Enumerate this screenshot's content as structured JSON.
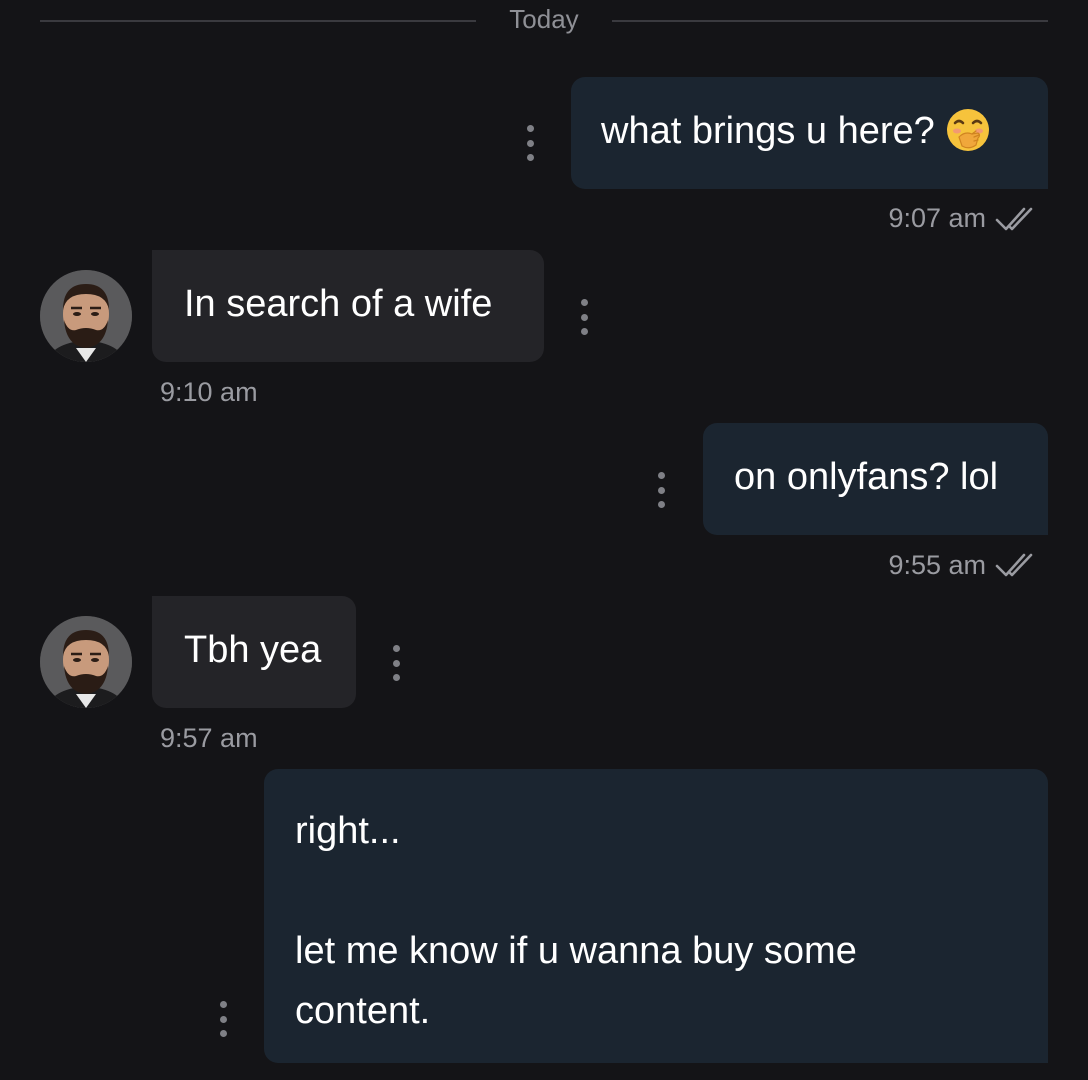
{
  "divider": {
    "label": "Today"
  },
  "messages": [
    {
      "direction": "outgoing",
      "text": "what brings u here?",
      "emoji": "hand-over-mouth-emoji",
      "time": "9:07 am",
      "status": "read"
    },
    {
      "direction": "incoming",
      "text": "In search of a wife",
      "time": "9:10 am",
      "avatar": "profile-avatar"
    },
    {
      "direction": "outgoing",
      "text": "on onlyfans? lol",
      "time": "9:55 am",
      "status": "read"
    },
    {
      "direction": "incoming",
      "text": "Tbh yea",
      "time": "9:57 am",
      "avatar": "profile-avatar"
    },
    {
      "direction": "outgoing",
      "lines": [
        "right...",
        "",
        "let me know if u wanna buy some",
        "content."
      ]
    }
  ],
  "colors": {
    "background": "#141417",
    "outgoing_bubble": "#1b2530",
    "incoming_bubble": "#242428",
    "meta_text": "#9a9ba1"
  }
}
